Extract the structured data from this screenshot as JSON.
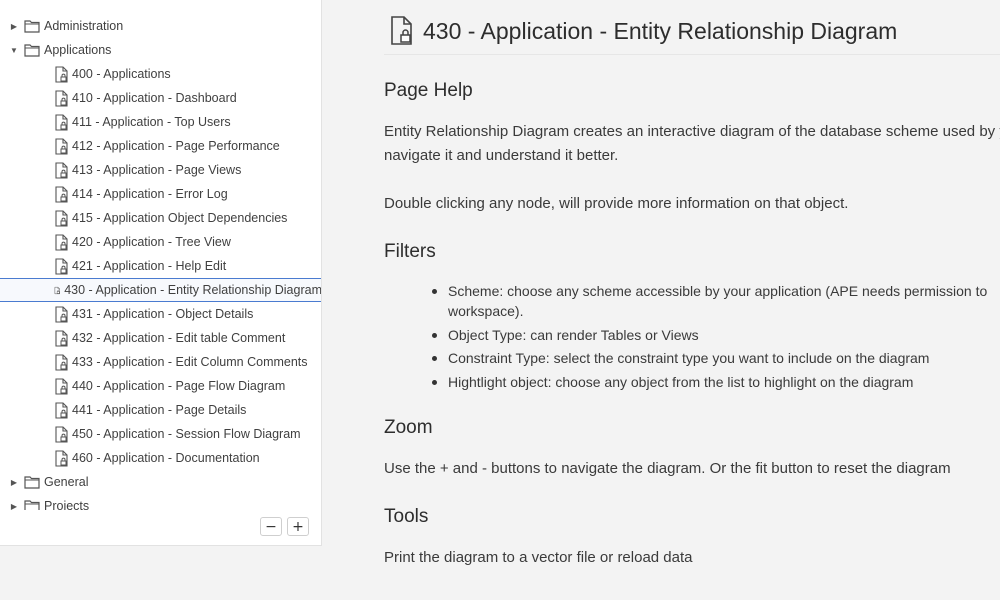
{
  "tree": {
    "items": [
      {
        "label": "Administration",
        "type": "folder",
        "expanded": false
      },
      {
        "label": "Applications",
        "type": "folder",
        "expanded": true
      },
      {
        "label": "400 - Applications",
        "type": "page"
      },
      {
        "label": "410 - Application - Dashboard",
        "type": "page"
      },
      {
        "label": "411 - Application - Top Users",
        "type": "page"
      },
      {
        "label": "412 - Application - Page Performance",
        "type": "page"
      },
      {
        "label": "413 - Application - Page Views",
        "type": "page"
      },
      {
        "label": "414 - Application - Error Log",
        "type": "page"
      },
      {
        "label": "415 - Application Object Dependencies",
        "type": "page"
      },
      {
        "label": "420 - Application - Tree View",
        "type": "page"
      },
      {
        "label": "421 - Application - Help Edit",
        "type": "page"
      },
      {
        "label": "430 - Application - Entity Relationship Diagram",
        "type": "page",
        "selected": true
      },
      {
        "label": "431 - Application - Object Details",
        "type": "page"
      },
      {
        "label": "432 - Application - Edit table Comment",
        "type": "page"
      },
      {
        "label": "433 - Application - Edit Column Comments",
        "type": "page"
      },
      {
        "label": "440 - Application - Page Flow Diagram",
        "type": "page"
      },
      {
        "label": "441 - Application - Page Details",
        "type": "page"
      },
      {
        "label": "450 - Application - Session Flow Diagram",
        "type": "page"
      },
      {
        "label": "460 - Application - Documentation",
        "type": "page"
      },
      {
        "label": "General",
        "type": "folder",
        "expanded": false
      },
      {
        "label": "Projects",
        "type": "folder",
        "expanded": false
      }
    ],
    "collapse_label": "−",
    "expand_label": "+"
  },
  "page": {
    "title": "430 - Application - Entity Relationship Diagram",
    "help_heading": "Page Help",
    "help_line1": "Entity Relationship Diagram creates an interactive diagram of the database scheme used by your application, so you can",
    "help_line2": "navigate it and understand it better.",
    "help_line3": "Double clicking any node, will provide more information on that object.",
    "filters_heading": "Filters",
    "filters": [
      "Scheme: choose any scheme accessible by your application (APE needs permission to",
      "workspace).",
      "Object Type: can render Tables or Views",
      "Constraint Type: select the constraint type you want to include on the diagram",
      "Hightlight object: choose any object from the list to highlight on the diagram"
    ],
    "zoom_heading": "Zoom",
    "zoom_text": "Use the + and - buttons to navigate the diagram. Or the fit button to reset the diagram",
    "tools_heading": "Tools",
    "tools_text": "Print the diagram to a vector file or reload data"
  }
}
